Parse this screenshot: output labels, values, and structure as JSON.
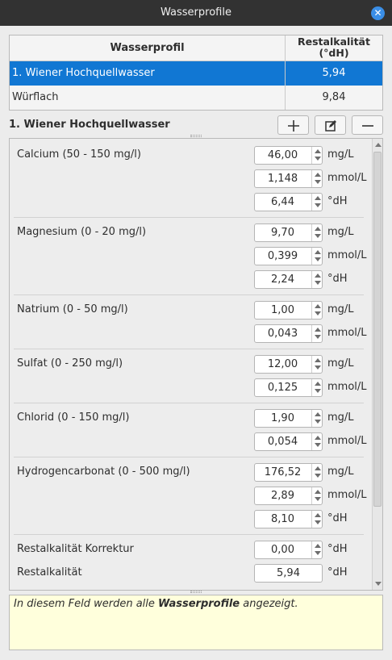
{
  "window": {
    "title": "Wasserprofile",
    "close_label": "✕"
  },
  "profiles_table": {
    "headers": {
      "name": "Wasserprofil",
      "restalkalitaet": "Restalkalität\n(°dH)"
    },
    "rows": [
      {
        "name": "1. Wiener Hochquellwasser",
        "value": "5,94"
      },
      {
        "name": "Würflach",
        "value": "9,84"
      }
    ]
  },
  "editor": {
    "title": "1. Wiener Hochquellwasser",
    "add_icon": "plus-icon",
    "edit_icon": "edit-icon",
    "remove_icon": "minus-icon"
  },
  "ions": {
    "calcium": {
      "label": "Calcium (50 - 150 mg/l)",
      "mg": "46,00",
      "mmol": "1,148",
      "dh": "6,44"
    },
    "magnesium": {
      "label": "Magnesium (0 - 20 mg/l)",
      "mg": "9,70",
      "mmol": "0,399",
      "dh": "2,24"
    },
    "natrium": {
      "label": "Natrium (0 - 50 mg/l)",
      "mg": "1,00",
      "mmol": "0,043"
    },
    "sulfat": {
      "label": "Sulfat (0 - 250 mg/l)",
      "mg": "12,00",
      "mmol": "0,125"
    },
    "chlorid": {
      "label": "Chlorid (0 - 150 mg/l)",
      "mg": "1,90",
      "mmol": "0,054"
    },
    "hydrogencarbonat": {
      "label": "Hydrogencarbonat (0 - 500 mg/l)",
      "mg": "176,52",
      "mmol": "2,89",
      "dh": "8,10"
    },
    "korrektur": {
      "label": "Restalkalität Korrektur",
      "dh": "0,00"
    },
    "restalkalitaet": {
      "label": "Restalkalität",
      "dh": "5,94"
    }
  },
  "units": {
    "mg": "mg/L",
    "mmol": "mmol/L",
    "dh": "°dH"
  },
  "info": {
    "pre": "In diesem Feld werden alle ",
    "bold": "Wasserprofile",
    "post": " angezeigt."
  },
  "colors": {
    "selection": "#1177d3",
    "info_bg": "#ffffdc",
    "titlebar": "#323232"
  }
}
